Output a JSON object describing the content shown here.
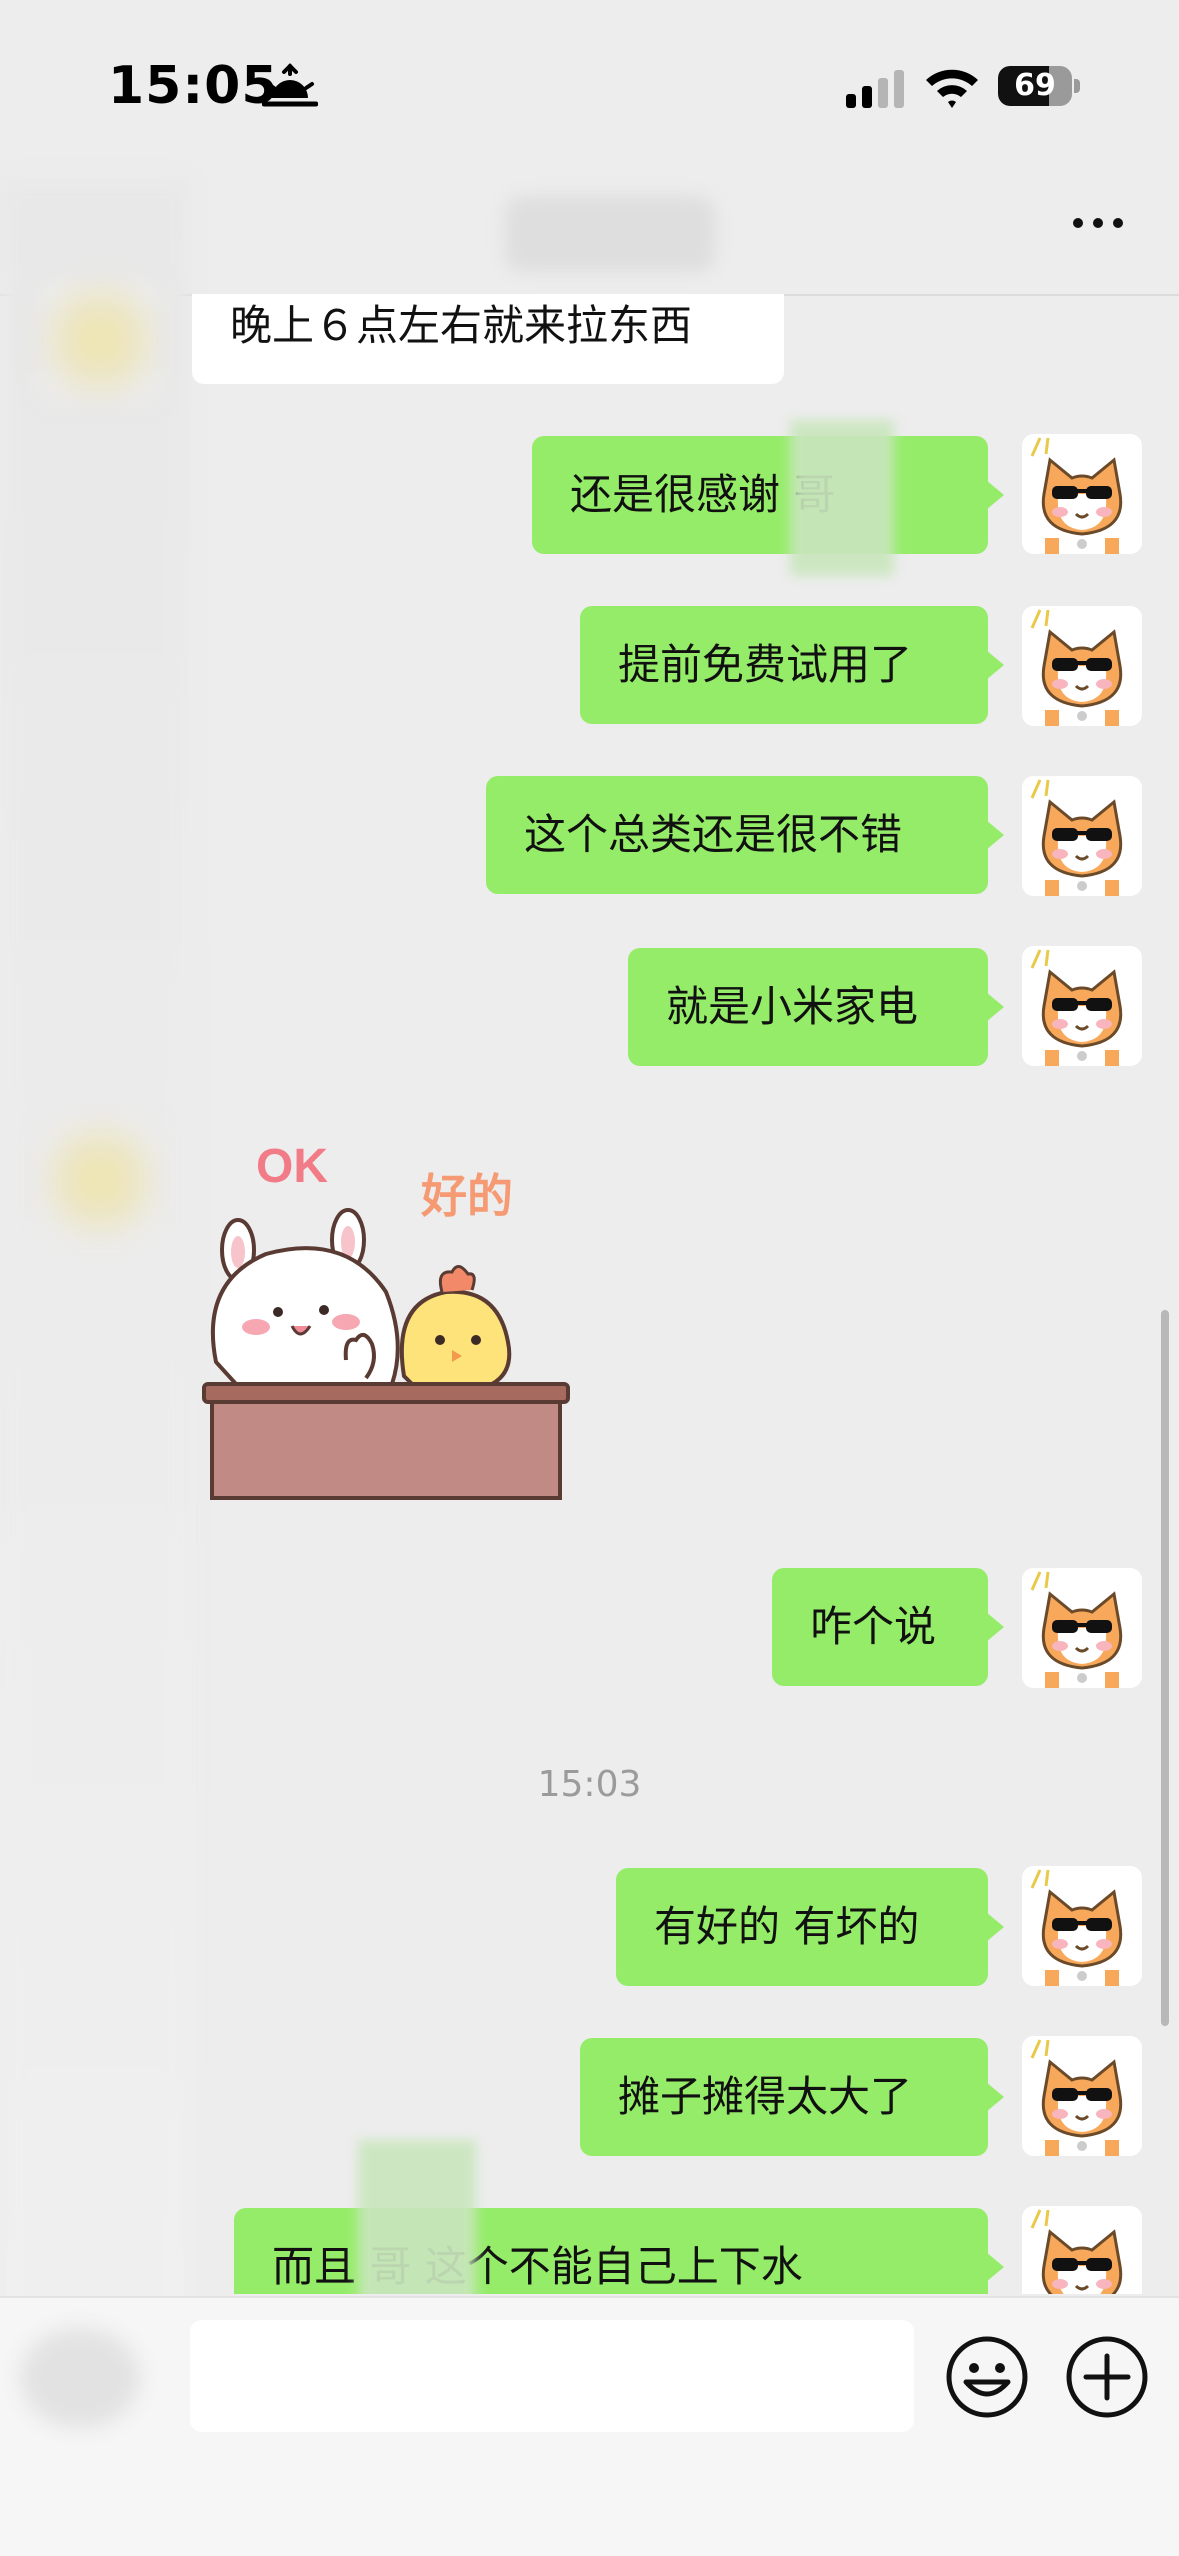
{
  "status": {
    "time": "15:05",
    "battery": "69",
    "battery_level": 0.69
  },
  "chat": {
    "incoming_text": "晚上６点左右就来拉东西",
    "messages": [
      {
        "text": "还是很感谢    哥"
      },
      {
        "text": "提前免费试用了"
      },
      {
        "text": "这个总类还是很不错"
      },
      {
        "text": "就是小米家电"
      },
      {
        "text": "咋个说"
      },
      {
        "text": "有好的 有坏的"
      },
      {
        "text": "摊子摊得太大了"
      },
      {
        "text": "而且    哥 这个不能自己上下水"
      }
    ],
    "timestamp": "15:03",
    "sticker": {
      "ok_text": "OK",
      "haode_text": "好的"
    }
  },
  "icons": {
    "more": "more-icon",
    "emoji": "emoji-icon",
    "plus": "plus-icon",
    "wifi": "wifi-icon",
    "signal": "signal-icon",
    "sunset": "sunset-icon"
  },
  "colors": {
    "outgoing_bubble": "#95EC69",
    "incoming_bubble": "#FFFFFF",
    "background": "#EDEDED"
  }
}
